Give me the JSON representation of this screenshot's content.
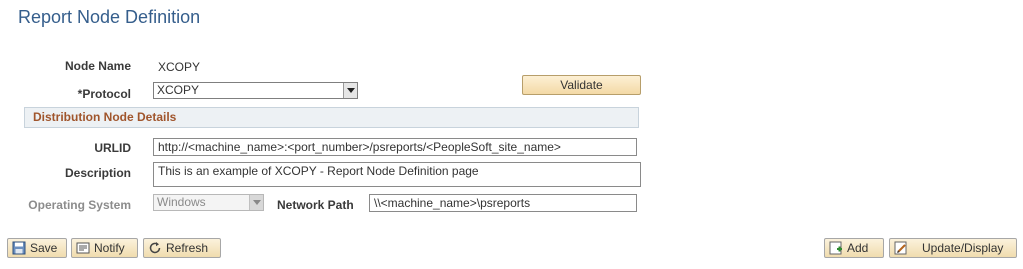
{
  "page": {
    "title": "Report Node Definition"
  },
  "node": {
    "name_label": "Node Name",
    "name_value": "XCOPY",
    "protocol_label": "*Protocol",
    "protocol_value": "XCOPY",
    "validate_label": "Validate"
  },
  "section": {
    "title": "Distribution Node Details"
  },
  "details": {
    "urlid_label": "URLID",
    "urlid_value": "http://<machine_name>:<port_number>/psreports/<PeopleSoft_site_name>",
    "description_label": "Description",
    "description_value": "This is an example of XCOPY - Report Node Definition page",
    "os_label": "Operating System",
    "os_value": "Windows",
    "network_path_label": "Network Path",
    "network_path_value": "\\\\<machine_name>\\psreports"
  },
  "toolbar": {
    "save_label": "Save",
    "notify_label": "Notify",
    "refresh_label": "Refresh",
    "add_label": "Add",
    "update_display_label": "Update/Display"
  },
  "icons": {
    "save": "save-icon",
    "notify": "notify-icon",
    "refresh": "refresh-icon",
    "add": "add-icon",
    "update_display": "update-display-icon"
  },
  "colors": {
    "title": "#355e8c",
    "section_title": "#a0552c",
    "section_bg": "#edf1f4",
    "button_gradient_top": "#fbf2dc",
    "button_gradient_bottom": "#f0dcae"
  }
}
